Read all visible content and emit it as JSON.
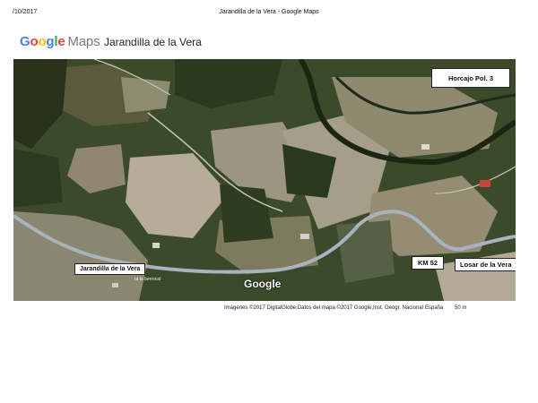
{
  "print_header": {
    "date": "/10/2017",
    "title": "Jarandilla de la Vera - Google Maps"
  },
  "logo": {
    "google_letters": [
      "G",
      "o",
      "o",
      "g",
      "l",
      "e"
    ],
    "maps": "Maps"
  },
  "place_title": "Jarandilla de la Vera",
  "map": {
    "labels": {
      "horcajo": "Horcajo Pol. 3",
      "jarandilla": "Jarandilla de la Vera",
      "km": "KM 52",
      "losar": "Losar de la Vera",
      "small_place": "ra la berrocal"
    },
    "watermark": "Google"
  },
  "attribution": {
    "text": "Imágenes ©2017 DigitalGlobe,Datos del mapa ©2017 Google,Inst. Geogr. Nacional",
    "country": "España",
    "scale": "50 m"
  },
  "colors": {
    "forest": "#3d4a2c",
    "field": "#a29a82",
    "road": "#aab4c2",
    "river": "#1e2a16"
  }
}
